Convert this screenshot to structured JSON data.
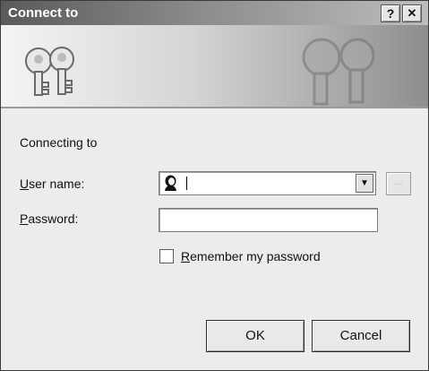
{
  "window": {
    "title": "Connect to",
    "help_button": "?",
    "close_button": "✕"
  },
  "form": {
    "connecting_label": "Connecting to",
    "username_label": "User name:",
    "username_access_key": "U",
    "username_rest": "ser name:",
    "username_value": "",
    "browse_label": "...",
    "password_label": "Password:",
    "password_access_key": "P",
    "password_rest": "assword:",
    "password_value": "",
    "remember_label": "Remember my password",
    "remember_access_key": "R",
    "remember_rest": "emember my password",
    "remember_checked": false
  },
  "buttons": {
    "ok": "OK",
    "cancel": "Cancel"
  },
  "icons": {
    "banner_left": "keys-icon",
    "banner_right": "keys-watermark-icon",
    "user": "user-icon",
    "dropdown": "dropdown-arrow-icon"
  }
}
